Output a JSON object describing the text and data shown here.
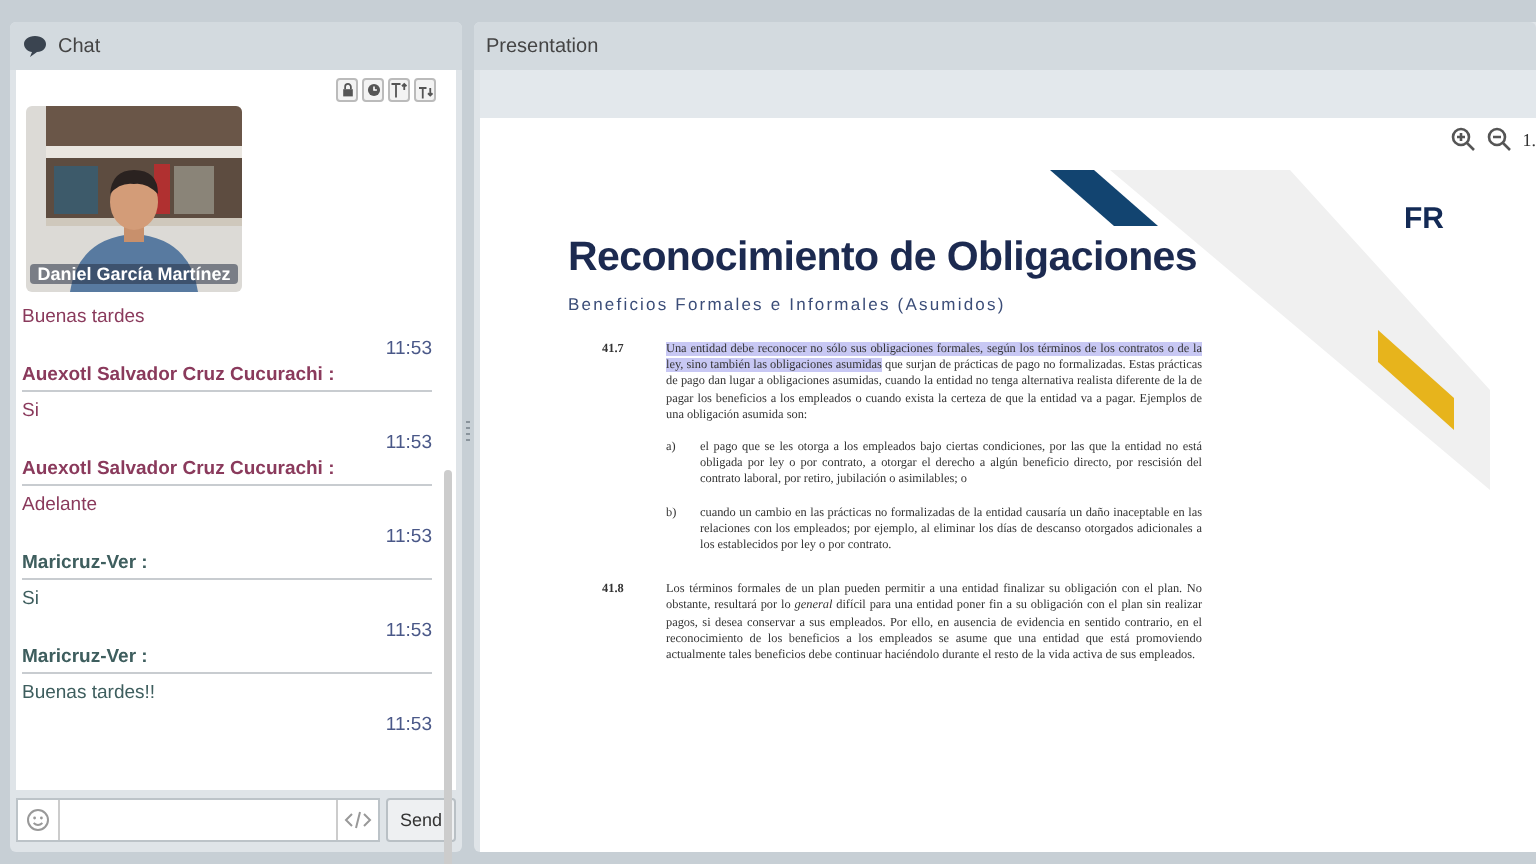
{
  "chat": {
    "title": "Chat",
    "toolbar": [
      {
        "kind": "lock"
      },
      {
        "kind": "clock"
      },
      {
        "kind": "font-up"
      },
      {
        "kind": "font-down"
      }
    ],
    "video": {
      "caption": "Daniel García Martínez"
    },
    "messages": [
      {
        "text": "Buenas tardes",
        "time": "11:53",
        "color": "#8a3a5c"
      },
      {
        "sender": "Auexotl Salvador Cruz Cucurachi :",
        "text": "Si",
        "time": "11:53",
        "color": "#8a3a5c"
      },
      {
        "sender": "Auexotl Salvador Cruz Cucurachi :",
        "text": "Adelante",
        "time": "11:53",
        "color": "#8a3a5c"
      },
      {
        "sender": "Maricruz-Ver :",
        "text": "Si",
        "time": "11:53",
        "color": "#3e5e5e"
      },
      {
        "sender": "Maricruz-Ver :",
        "text": "Buenas tardes!!",
        "time": "11:53",
        "color": "#3e5e5e"
      }
    ],
    "send_button": "Send"
  },
  "presentation": {
    "title": "Presentation",
    "zoom_reading": "1.",
    "slide": {
      "logo": "FR",
      "title": "Reconocimiento de Obligaciones",
      "subtitle": "Beneficios Formales e Informales (Asumidos)",
      "sections": [
        {
          "number": "41.7",
          "highlighted": "Una entidad debe reconocer no sólo sus obligaciones formales, según los términos de los contratos o de la ley, sino también las obligaciones asumidas",
          "text": " que surjan de prácticas de pago no formalizadas. Estas prácticas de pago dan lugar a obligaciones asumidas, cuando la entidad no tenga alternativa realista diferente de la de pagar los beneficios a los empleados o cuando exista la certeza de que la entidad va a pagar. Ejemplos de una obligación asumida son:",
          "items": [
            {
              "label": "a)",
              "text": "el pago que se les otorga a los empleados bajo ciertas condiciones, por las que la entidad no está obligada por ley o por contrato, a otorgar el derecho a algún beneficio directo, por rescisión del contrato laboral, por retiro, jubilación o asimilables; o"
            },
            {
              "label": "b)",
              "text": "cuando un cambio en las prácticas no formalizadas de la entidad causaría un daño inaceptable en las relaciones con los empleados; por ejemplo, al eliminar los días de descanso otorgados adicionales a los establecidos por ley o por contrato."
            }
          ]
        },
        {
          "number": "41.8",
          "text": "Los términos formales de un plan pueden permitir a una entidad finalizar su obligación con el plan. No obstante, resultará por lo *general* difícil para una entidad poner fin a su obligación con el plan sin realizar pagos, si desea conservar a sus empleados. Por ello, en ausencia de evidencia en sentido contrario, en el reconocimiento de los beneficios a los empleados se asume que una entidad que está promoviendo actualmente tales beneficios debe continuar haciéndolo durante el resto de la vida activa de sus empleados."
        }
      ]
    }
  }
}
